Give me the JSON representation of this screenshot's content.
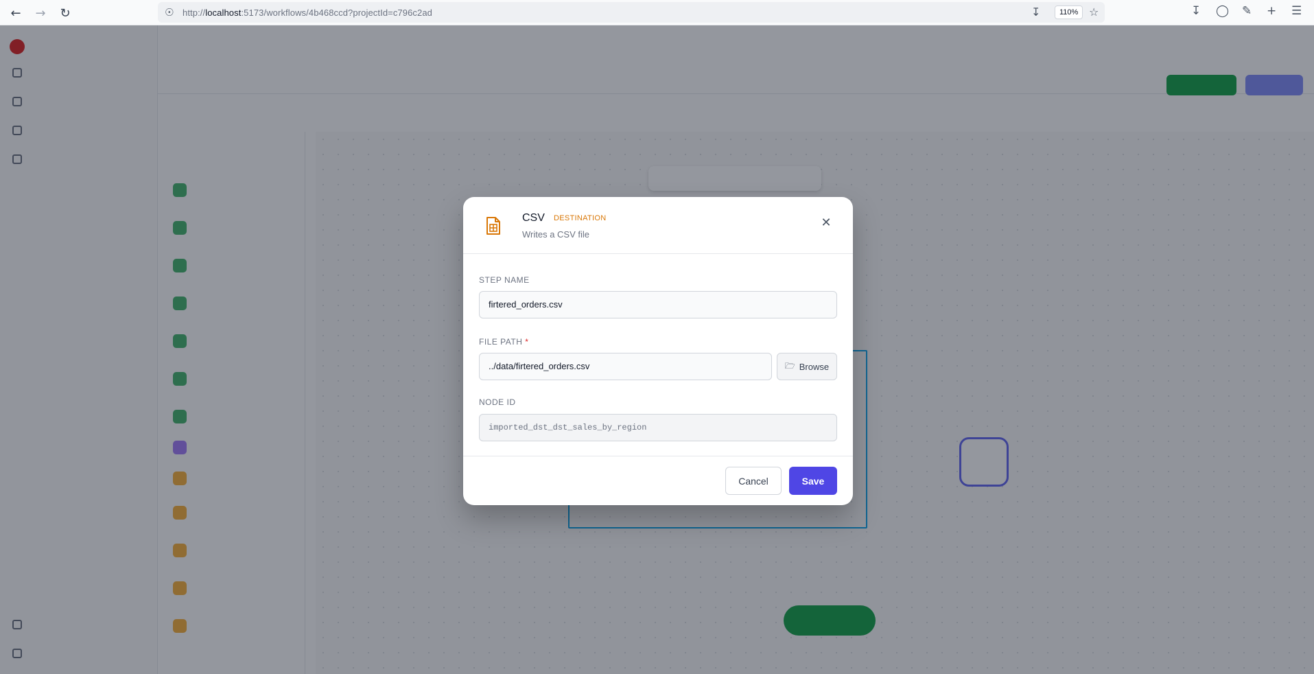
{
  "browser": {
    "url_prefix": "http://",
    "url_host": "localhost",
    "url_rest": ":5173/workflows/4b468ccd?projectId=c796c2ad",
    "zoom": "110%"
  },
  "modal": {
    "title": "CSV",
    "badge": "DESTINATION",
    "subtitle": "Writes a CSV file",
    "icon": "file-spreadsheet-icon",
    "accent_color": "#d97706",
    "step_name": {
      "label": "STEP NAME",
      "value": "firtered_orders.csv"
    },
    "file_path": {
      "label": "FILE PATH",
      "required_mark": "*",
      "value": "../data/firtered_orders.csv",
      "browse_label": "Browse"
    },
    "node_id": {
      "label": "NODE ID",
      "value": "imported_dst_dst_sales_by_region"
    },
    "cancel_label": "Cancel",
    "save_label": "Save",
    "primary_color": "#4f46e5"
  }
}
